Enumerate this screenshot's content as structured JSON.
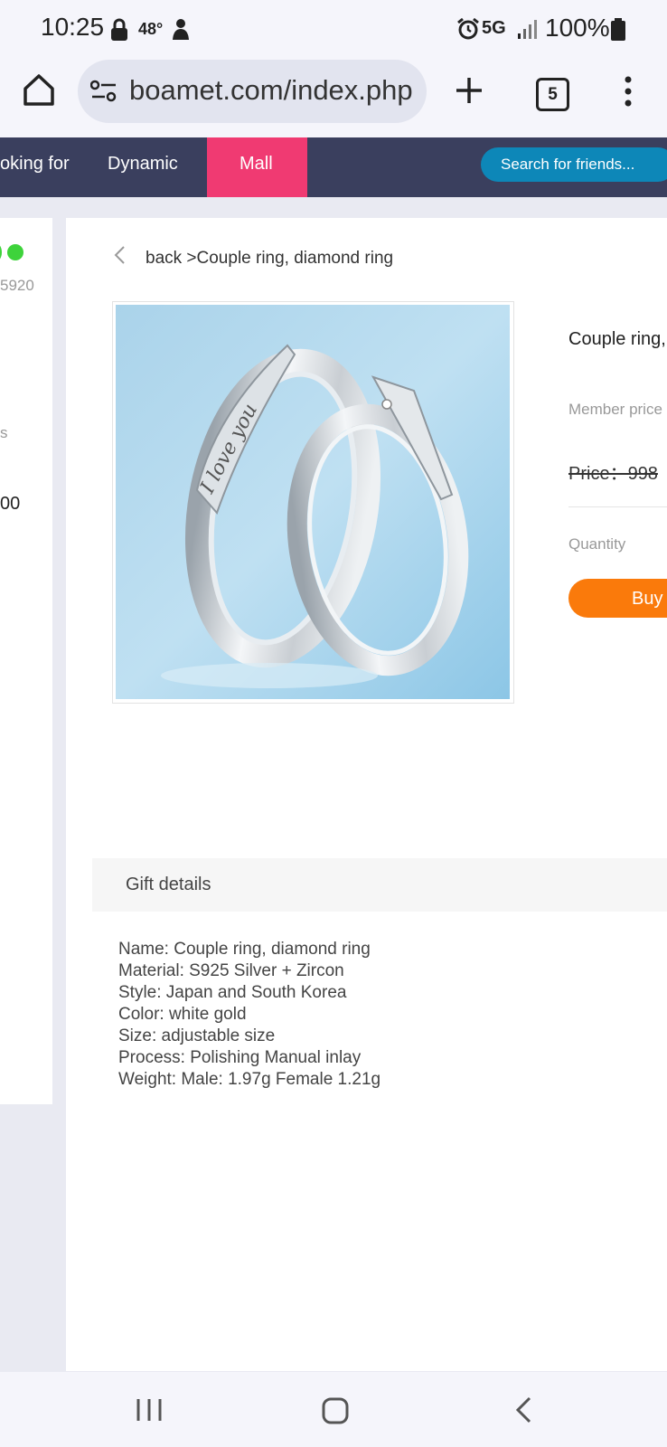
{
  "status_bar": {
    "time": "10:25",
    "temperature": "48°",
    "network": "5G",
    "battery": "100%"
  },
  "browser": {
    "url": "boamet.com/index.php",
    "tab_count": "5"
  },
  "site_nav": {
    "items": [
      "oking for",
      "Dynamic",
      "Mall"
    ],
    "search_placeholder": "Search for friends..."
  },
  "left_panel": {
    "id_fragment": "5920",
    "text_fragment": "s",
    "number_fragment": "00"
  },
  "breadcrumb": {
    "back_label": "back >",
    "current": "Couple ring, diamond ring"
  },
  "product": {
    "title": "Couple ring,",
    "member_price_label": "Member price",
    "price": "Price：998",
    "quantity_label": "Quantity",
    "buy_label": "Buy",
    "image_alt": "Couple ring, diamond ring",
    "engraving_text": "I love you"
  },
  "gift_details": {
    "title": "Gift details",
    "lines": [
      "Name: Couple ring, diamond ring",
      "Material: S925 Silver + Zircon",
      "Style: Japan and South Korea",
      "Color: white gold",
      "Size: adjustable size",
      "Process: Polishing Manual inlay",
      "Weight: Male: 1.97g Female 1.21g"
    ]
  },
  "colors": {
    "nav_bg": "#3a3f5e",
    "mall_accent": "#f03a72",
    "search_bg": "#0d87b8",
    "buy_button": "#fa7a0b",
    "online_dot": "#3ed33b"
  },
  "icons": [
    "lock-icon",
    "user-icon",
    "alarm-icon",
    "signal-icon",
    "battery-icon",
    "home-icon",
    "site-settings-icon",
    "new-tab-icon",
    "tab-switcher-icon",
    "more-menu-icon",
    "back-chevron-icon",
    "recent-apps-icon",
    "home-button-icon",
    "system-back-icon"
  ]
}
